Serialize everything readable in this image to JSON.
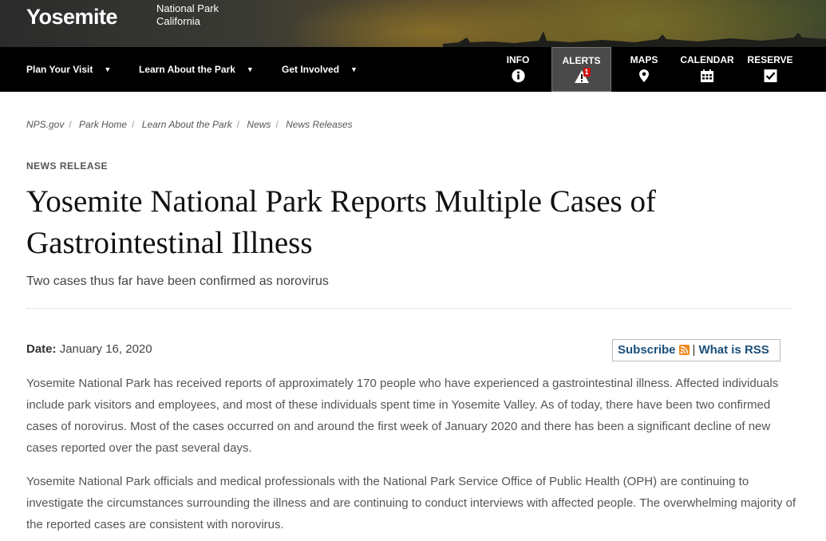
{
  "header": {
    "brand": "Yosemite",
    "brand_sub_line1": "National Park",
    "brand_sub_line2": "California"
  },
  "nav": {
    "items": [
      {
        "label": "Plan Your Visit"
      },
      {
        "label": "Learn About the Park"
      },
      {
        "label": "Get Involved"
      }
    ],
    "utility": {
      "info": "INFO",
      "alerts": "ALERTS",
      "alerts_count": "1",
      "maps": "MAPS",
      "calendar": "CALENDAR",
      "reserve": "RESERVE"
    }
  },
  "breadcrumb": [
    "NPS.gov",
    "Park Home",
    "Learn About the Park",
    "News",
    "News Releases"
  ],
  "article": {
    "kicker": "NEWS RELEASE",
    "title": "Yosemite National Park Reports Multiple Cases of Gastrointestinal Illness",
    "subtitle": "Two cases thus far have been confirmed as norovirus",
    "date_label": "Date:",
    "date_value": "January 16, 2020",
    "subscribe": "Subscribe",
    "separator": "|",
    "what_is_rss": "What is RSS",
    "paragraphs": [
      "Yosemite National Park has received reports of approximately 170 people who have experienced a gastrointestinal illness. Affected individuals include park visitors and employees, and most of these individuals spent time in Yosemite Valley. As of today, there have been two confirmed cases of norovirus. Most of the cases occurred on and around the first week of January 2020 and there has been a significant decline of new cases reported over the past several days.",
      "Yosemite National Park officials and medical professionals with the National Park Service Office of Public Health (OPH) are continuing to investigate the circumstances surrounding the illness and are continuing to conduct interviews with affected people. The overwhelming majority of the reported cases are consistent with norovirus."
    ]
  },
  "icons": {
    "info": "info-circle-icon",
    "alerts": "warning-triangle-icon",
    "maps": "map-pin-icon",
    "calendar": "calendar-icon",
    "reserve": "checkbox-icon",
    "rss": "rss-feed-icon"
  },
  "colors": {
    "nav_bg": "#000000",
    "link": "#1a4f7a",
    "rss_orange": "#f08a1d",
    "alert_red": "#cc1111"
  }
}
